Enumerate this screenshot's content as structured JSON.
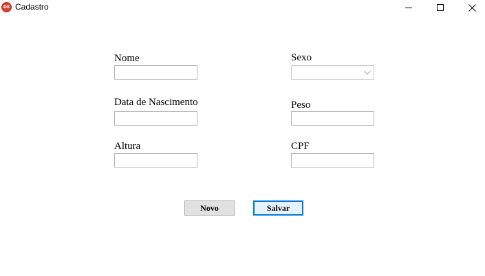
{
  "window": {
    "title": "Cadastro",
    "icon": "devexpress-dx-icon",
    "icon_text": "DX",
    "controls": [
      "minimize-icon",
      "maximize-icon",
      "close-icon"
    ]
  },
  "form": {
    "nome": {
      "label": "Nome",
      "value": ""
    },
    "data_nascimento": {
      "label": "Data de Nascimento",
      "value": ""
    },
    "altura": {
      "label": "Altura",
      "value": ""
    },
    "sexo": {
      "label": "Sexo",
      "value": "",
      "options": []
    },
    "peso": {
      "label": "Peso",
      "value": ""
    },
    "cpf": {
      "label": "CPF",
      "value": ""
    }
  },
  "buttons": {
    "novo": "Novo",
    "salvar": "Salvar"
  },
  "colors": {
    "background": "#ffffff",
    "input_border": "#b5b5b5",
    "button_face": "#e1e1e1",
    "default_button_border": "#0078d7"
  }
}
